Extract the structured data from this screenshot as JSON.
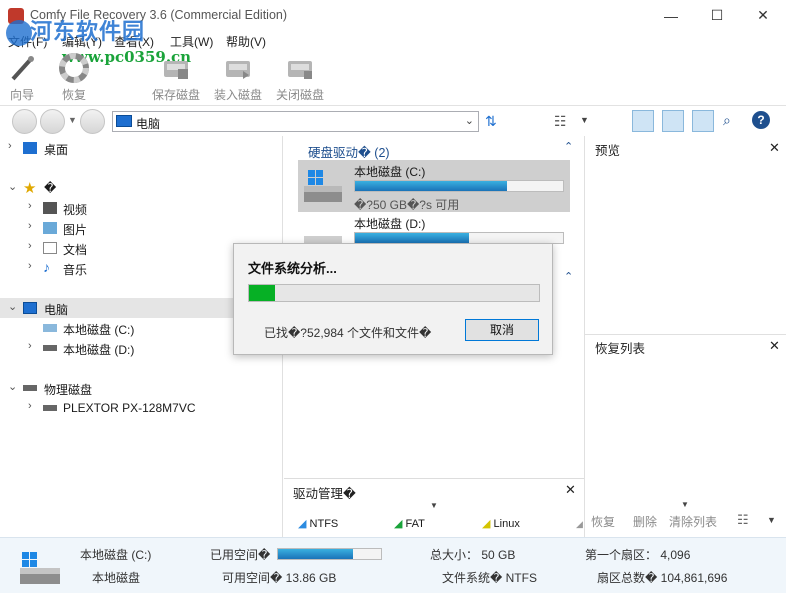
{
  "window": {
    "title": "Comfy File Recovery 3.6 (Commercial Edition)",
    "minimize_glyph": "—",
    "maximize_glyph": "☐",
    "close_glyph": "✕"
  },
  "watermark": {
    "text": "河东软件园",
    "url": "www.pc0359.cn"
  },
  "menu": [
    "文件(F)",
    "编辑(Y)",
    "查看(X)",
    "工具(W)",
    "帮助(V)"
  ],
  "toolbar": {
    "wizard": "向导",
    "recover": "恢复",
    "save_disk": "保存磁盘",
    "load_disk": "装入磁盘",
    "close_disk": "关闭磁盘"
  },
  "address": {
    "value": "电脑"
  },
  "tree": {
    "desktop": "桌面",
    "favorites": "�",
    "videos": "视频",
    "pictures": "图片",
    "documents": "文档",
    "music": "音乐",
    "computer": "电脑",
    "local_c": "本地磁盘 (C:)",
    "local_d": "本地磁盘 (D:)",
    "physical": "物理磁盘",
    "plextor": "PLEXTOR PX-128M7VC"
  },
  "drives_section": {
    "header": "硬盘驱动� (2)",
    "c_name": "本地磁盘 (C:)",
    "c_free": "�?50 GB�?s 可用",
    "c_usage": 0.73,
    "d_name": "本地磁盘 (D:)",
    "d_usage": 0.55
  },
  "drive_manager": {
    "title": "驱动管理�",
    "fs": [
      "NTFS",
      "FAT",
      "Linux"
    ],
    "colors": [
      "#2b8be0",
      "#1aa33a",
      "#d4c400"
    ]
  },
  "preview": {
    "title": "预览"
  },
  "recovery_list": {
    "title": "恢复列表",
    "actions": [
      "恢复",
      "删除",
      "清除列表"
    ]
  },
  "dialog": {
    "title": "文件系统分析...",
    "progress": 0.09,
    "status": "已找�?52,984 个文件和文件�",
    "cancel": "取消"
  },
  "status": {
    "drive_name": "本地磁盘 (C:)",
    "drive_type": "本地磁盘",
    "used_label": "已用空间�",
    "used_fraction": 0.73,
    "free_label": "可用空间� 13.86 GB",
    "total": "总大小： 50 GB",
    "fs": "文件系统� NTFS",
    "first_sector": "第一个扇区： 4,096",
    "sectors": "扇区总数� 104,861,696"
  }
}
